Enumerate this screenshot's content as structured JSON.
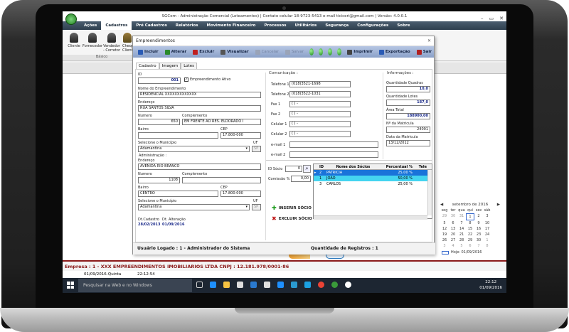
{
  "app": {
    "title": "SGCom - Administração Comercial (Loteamentos) | Contato celular 18-9723-5413 e-mail ticiceri@gmail.com | Versão: 4.0.0.1"
  },
  "menu": [
    "Ações",
    "Cadastros",
    "Pré Cadastros",
    "Relatórios",
    "Movimento Financeiro",
    "Processos",
    "Utilitários",
    "Segurança",
    "Configurações",
    "Sobre"
  ],
  "ribbon": {
    "buttons": [
      "Cliente",
      "Fornecedor",
      "Vendedor - Corretor",
      "Cheque Client"
    ],
    "group_label": "Básico"
  },
  "window": {
    "title": "Empreendimentos",
    "toolbar": [
      {
        "label": "Incluir",
        "enabled": true,
        "color": "#2a5bb5"
      },
      {
        "label": "Alterar",
        "enabled": true,
        "color": "#2a8a2a"
      },
      {
        "label": "Excluir",
        "enabled": true,
        "color": "#c02020"
      },
      {
        "label": "Visualizar",
        "enabled": true,
        "color": "#555555"
      },
      {
        "label": "Cancelar",
        "enabled": false,
        "color": "#9aa4b8"
      },
      {
        "label": "Salvar",
        "enabled": false,
        "color": "#9aa4b8"
      },
      {
        "label": "Imprimir",
        "enabled": true,
        "color": "#444444"
      },
      {
        "label": "Exportação",
        "enabled": true,
        "color": "#2a5bb5"
      },
      {
        "label": "Sair",
        "enabled": true,
        "color": "#b02020"
      }
    ],
    "tabs": [
      "Cadastro",
      "Imagem",
      "Lotes"
    ],
    "form": {
      "id_label": "ID",
      "id_value": "001",
      "ativo_label": "Empreendimento Ativo",
      "ativo_checked": true,
      "nome_label": "Nome do Empreendimento",
      "nome_value": "RESIDENCIAL XXXXXXXXXXXXX",
      "endereco_label": "Endereço",
      "endereco_value": "RUA SANTOS SILVA",
      "numero_label": "Numero",
      "numero_value": "650",
      "complemento_label": "Complemento",
      "complemento_value": "EM FRENTE AO RES. ELDORADO I",
      "bairro_label": "Bairro",
      "bairro_value": "",
      "cep_label": "CEP",
      "cep_value": "17.800-000",
      "municipio_label": "Selecione o Município",
      "municipio_value": "Adamantina",
      "uf_label": "UF",
      "uf_value": "SP",
      "admin_label": "Administração :",
      "adm_endereco_label": "Endereço",
      "adm_endereco_value": "AVENIDA RIO BRANCO",
      "adm_numero_label": "Numero",
      "adm_numero_value": "1108",
      "adm_complemento_label": "Complemento",
      "adm_complemento_value": "",
      "adm_bairro_label": "Bairro",
      "adm_bairro_value": "CENTRO",
      "adm_cep_label": "CEP",
      "adm_cep_value": "17.800-000",
      "adm_municipio_label": "Selecione o Município",
      "adm_municipio_value": "Adamantina",
      "adm_uf_label": "UF",
      "adm_uf_value": "SP",
      "dt_cadastro_label": "Dt.Cadastro",
      "dt_cadastro_value": "28/02/2013",
      "dt_alteracao_label": "Dt. Alteração",
      "dt_alteracao_value": "01/09/2016"
    },
    "comunicacao": {
      "label": "Comunicação :",
      "fields": [
        {
          "label": "Telefone 1",
          "value": "(018)3521-1698"
        },
        {
          "label": "Telefone 2",
          "value": "(018)3522-1031"
        },
        {
          "label": "Fax 1",
          "value": "(  )    -"
        },
        {
          "label": "Fax 2",
          "value": "(  )    -"
        },
        {
          "label": "Celular 1",
          "value": "(  )    -"
        },
        {
          "label": "Celular 2",
          "value": "(  )    -"
        },
        {
          "label": "e-mail 1",
          "value": ""
        },
        {
          "label": "e-mail 2",
          "value": ""
        }
      ]
    },
    "informacoes": {
      "label": "Informações :",
      "quadras_label": "Quantidade Quadras",
      "quadras_value": "10,0",
      "lotes_label": "Quantidade Lotes",
      "lotes_value": "187,0",
      "area_label": "Área Total",
      "area_value": "188900,00",
      "matricula_label": "Nº da Matricula",
      "matricula_value": "24091",
      "data_matricula_label": "Data da Matricula",
      "data_matricula_value": "13/12/2012"
    },
    "socio": {
      "id_label": "ID Sócio",
      "id_value": "0",
      "comissao_label": "Comissão %",
      "comissao_value": "0,00",
      "inserir_label": "INSERIR SÓCIO",
      "excluir_label": "EXCLUIR SÓCIO",
      "columns": [
        "ID",
        "Nome dos Sócios",
        "Percentual %",
        "Tele"
      ],
      "rows": [
        {
          "id": "2",
          "nome": "PATRICIA",
          "perc": "25,00 %",
          "style": "sel"
        },
        {
          "id": "1",
          "nome": "JOÃO",
          "perc": "50,00 %",
          "style": "cy"
        },
        {
          "id": "3",
          "nome": "CARLOS",
          "perc": "25,00 %",
          "style": ""
        }
      ]
    },
    "status": {
      "user": "Usuário Logado : 1 - Administrador do Sistema",
      "registros": "Quantidade de Registros : 1"
    }
  },
  "calendar": {
    "title": "setembro de 2016",
    "days": [
      "seg",
      "ter",
      "qua",
      "qui",
      "sex",
      "sáb"
    ],
    "weeks": [
      [
        "29",
        "30",
        "31",
        "1",
        "2",
        "3"
      ],
      [
        "5",
        "6",
        "7",
        "8",
        "9",
        "10"
      ],
      [
        "12",
        "13",
        "14",
        "15",
        "16",
        "17"
      ],
      [
        "19",
        "20",
        "21",
        "22",
        "23",
        "24"
      ],
      [
        "26",
        "27",
        "28",
        "29",
        "30",
        "1"
      ],
      [
        "3",
        "4",
        "5",
        "6",
        "7",
        "8"
      ]
    ],
    "today_label": "Hoje: 01/09/2016"
  },
  "empresa_bar": "Empresa : 1 - XXX EMPREENDIMENTOS IMOBILIARIOS LTDA  CNPJ : 12.181.978/0001-86",
  "datebar": {
    "date": "01/09/2016-Quinta",
    "time": "22:12:54"
  },
  "taskbar": {
    "search_placeholder": "Pesquisar na Web e no Windows",
    "time": "22:12",
    "date": "01/09/2016"
  }
}
